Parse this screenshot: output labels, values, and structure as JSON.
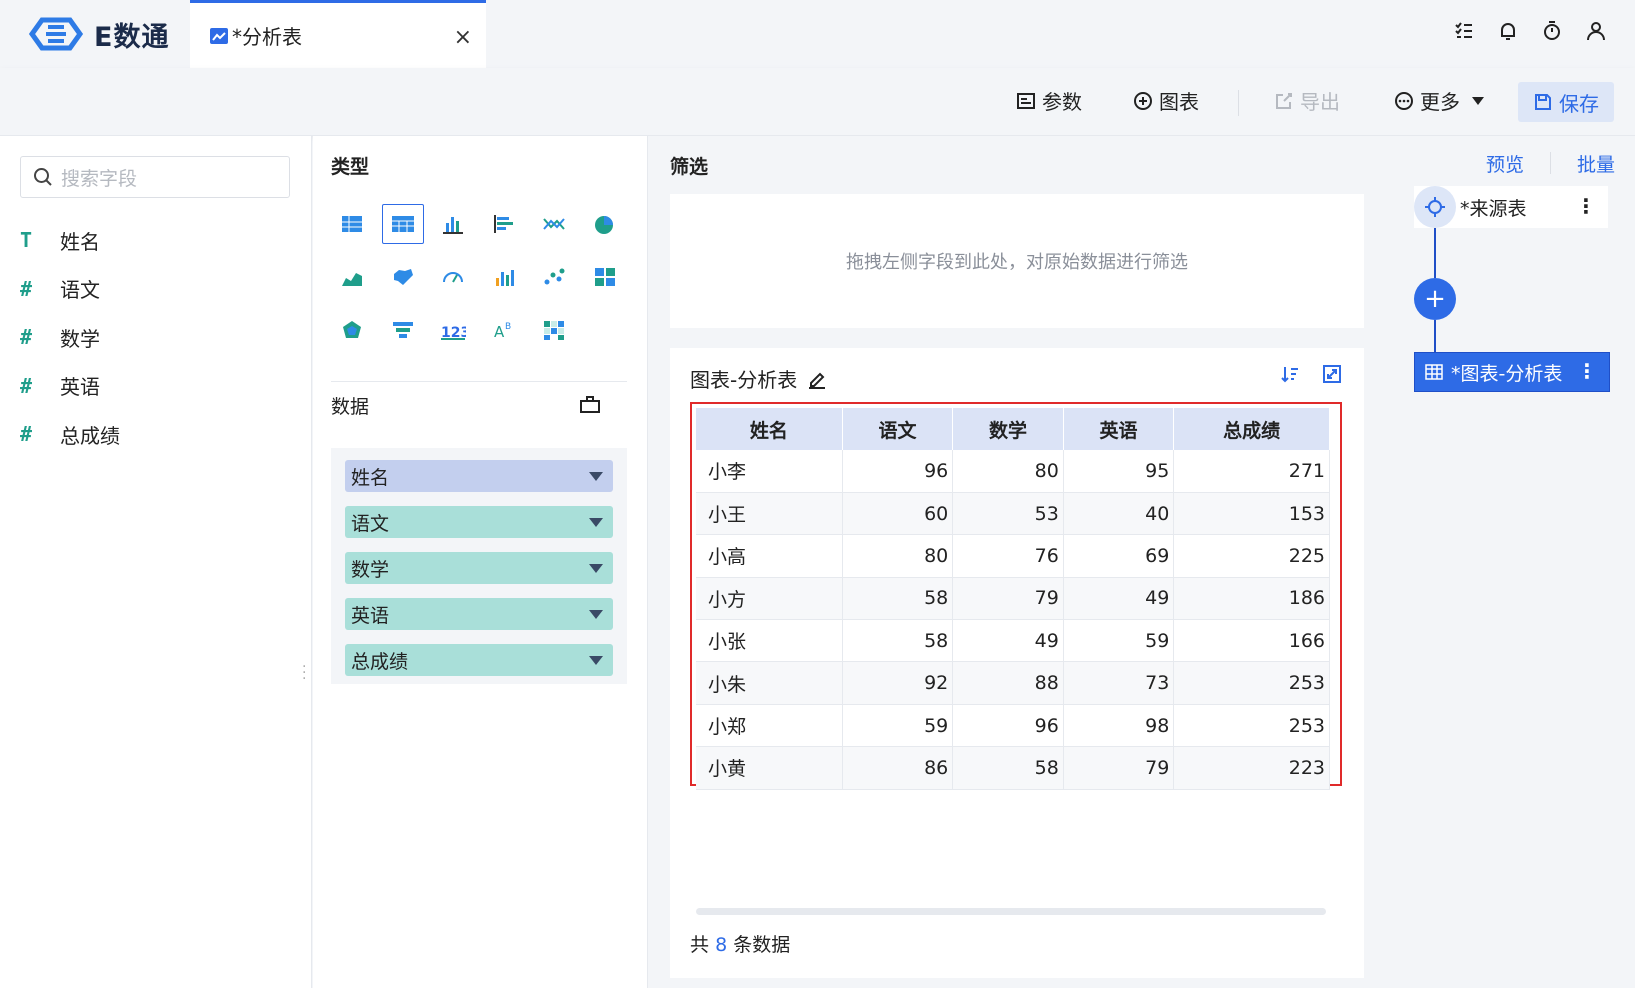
{
  "app": {
    "name": "E数通"
  },
  "tab": {
    "label": "*分析表",
    "close": "×"
  },
  "toolbar": {
    "params": "参数",
    "chart": "图表",
    "export": "导出",
    "more": "更多",
    "save": "保存"
  },
  "left": {
    "search_placeholder": "搜索字段",
    "fields": [
      {
        "label": "姓名",
        "type": "T"
      },
      {
        "label": "语文",
        "type": "#"
      },
      {
        "label": "数学",
        "type": "#"
      },
      {
        "label": "英语",
        "type": "#"
      },
      {
        "label": "总成绩",
        "type": "#"
      }
    ]
  },
  "middle": {
    "type_title": "类型",
    "data_title": "数据",
    "chips": [
      {
        "label": "姓名",
        "kind": "dim"
      },
      {
        "label": "语文",
        "kind": "mea"
      },
      {
        "label": "数学",
        "kind": "mea"
      },
      {
        "label": "英语",
        "kind": "mea"
      },
      {
        "label": "总成绩",
        "kind": "mea"
      }
    ]
  },
  "main": {
    "filter_title": "筛选",
    "filter_hint": "拖拽左侧字段到此处，对原始数据进行筛选",
    "chart_title": "图表-分析表",
    "table": {
      "headers": [
        "姓名",
        "语文",
        "数学",
        "英语",
        "总成绩"
      ],
      "rows": [
        [
          "小李",
          "96",
          "80",
          "95",
          "271"
        ],
        [
          "小王",
          "60",
          "53",
          "40",
          "153"
        ],
        [
          "小高",
          "80",
          "76",
          "69",
          "225"
        ],
        [
          "小方",
          "58",
          "79",
          "49",
          "186"
        ],
        [
          "小张",
          "58",
          "49",
          "59",
          "166"
        ],
        [
          "小朱",
          "92",
          "88",
          "73",
          "253"
        ],
        [
          "小郑",
          "59",
          "96",
          "98",
          "253"
        ],
        [
          "小黄",
          "86",
          "58",
          "79",
          "223"
        ]
      ]
    },
    "count_prefix": "共",
    "count_value": "8",
    "count_suffix": "条数据"
  },
  "right": {
    "preview": "预览",
    "batch": "批量",
    "source_node": "*来源表",
    "chart_node": "*图表-分析表",
    "plus": "+"
  },
  "colors": {
    "accent": "#2e6be6",
    "dimension": "#c3cfee",
    "measure": "#a9dfd9",
    "highlight": "#e02a2a"
  }
}
